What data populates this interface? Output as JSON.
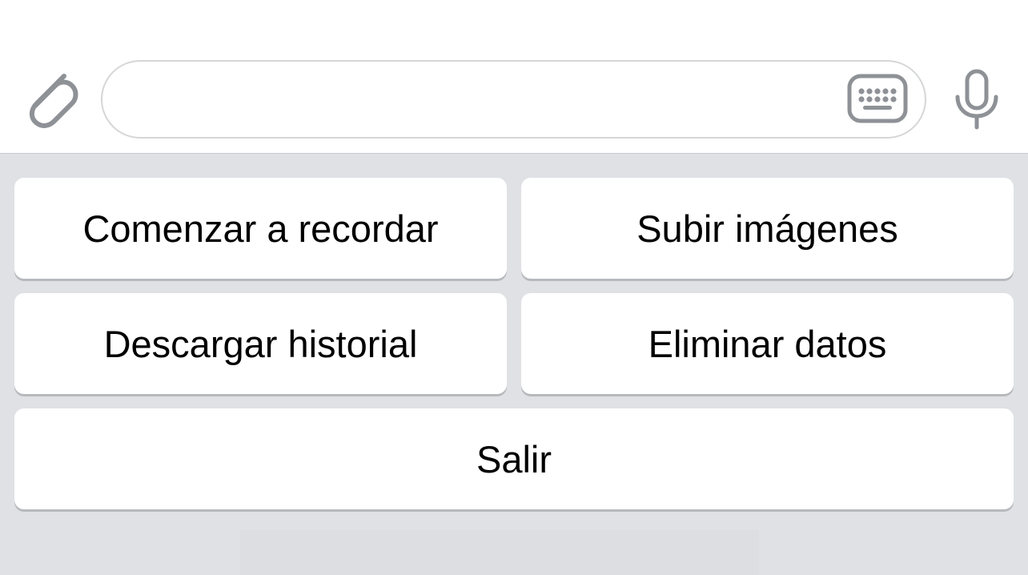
{
  "composer": {
    "input_value": "",
    "input_placeholder": "",
    "icons": {
      "attach": "paperclip-icon",
      "keyboard": "keyboard-icon",
      "microphone": "microphone-icon"
    },
    "icon_color": "#8e9196"
  },
  "keyboard": {
    "background_color": "#dfe1e5",
    "buttons": [
      {
        "label": "Comenzar a recordar"
      },
      {
        "label": "Subir imágenes"
      },
      {
        "label": "Descargar historial"
      },
      {
        "label": "Eliminar datos"
      },
      {
        "label": "Salir"
      }
    ]
  }
}
